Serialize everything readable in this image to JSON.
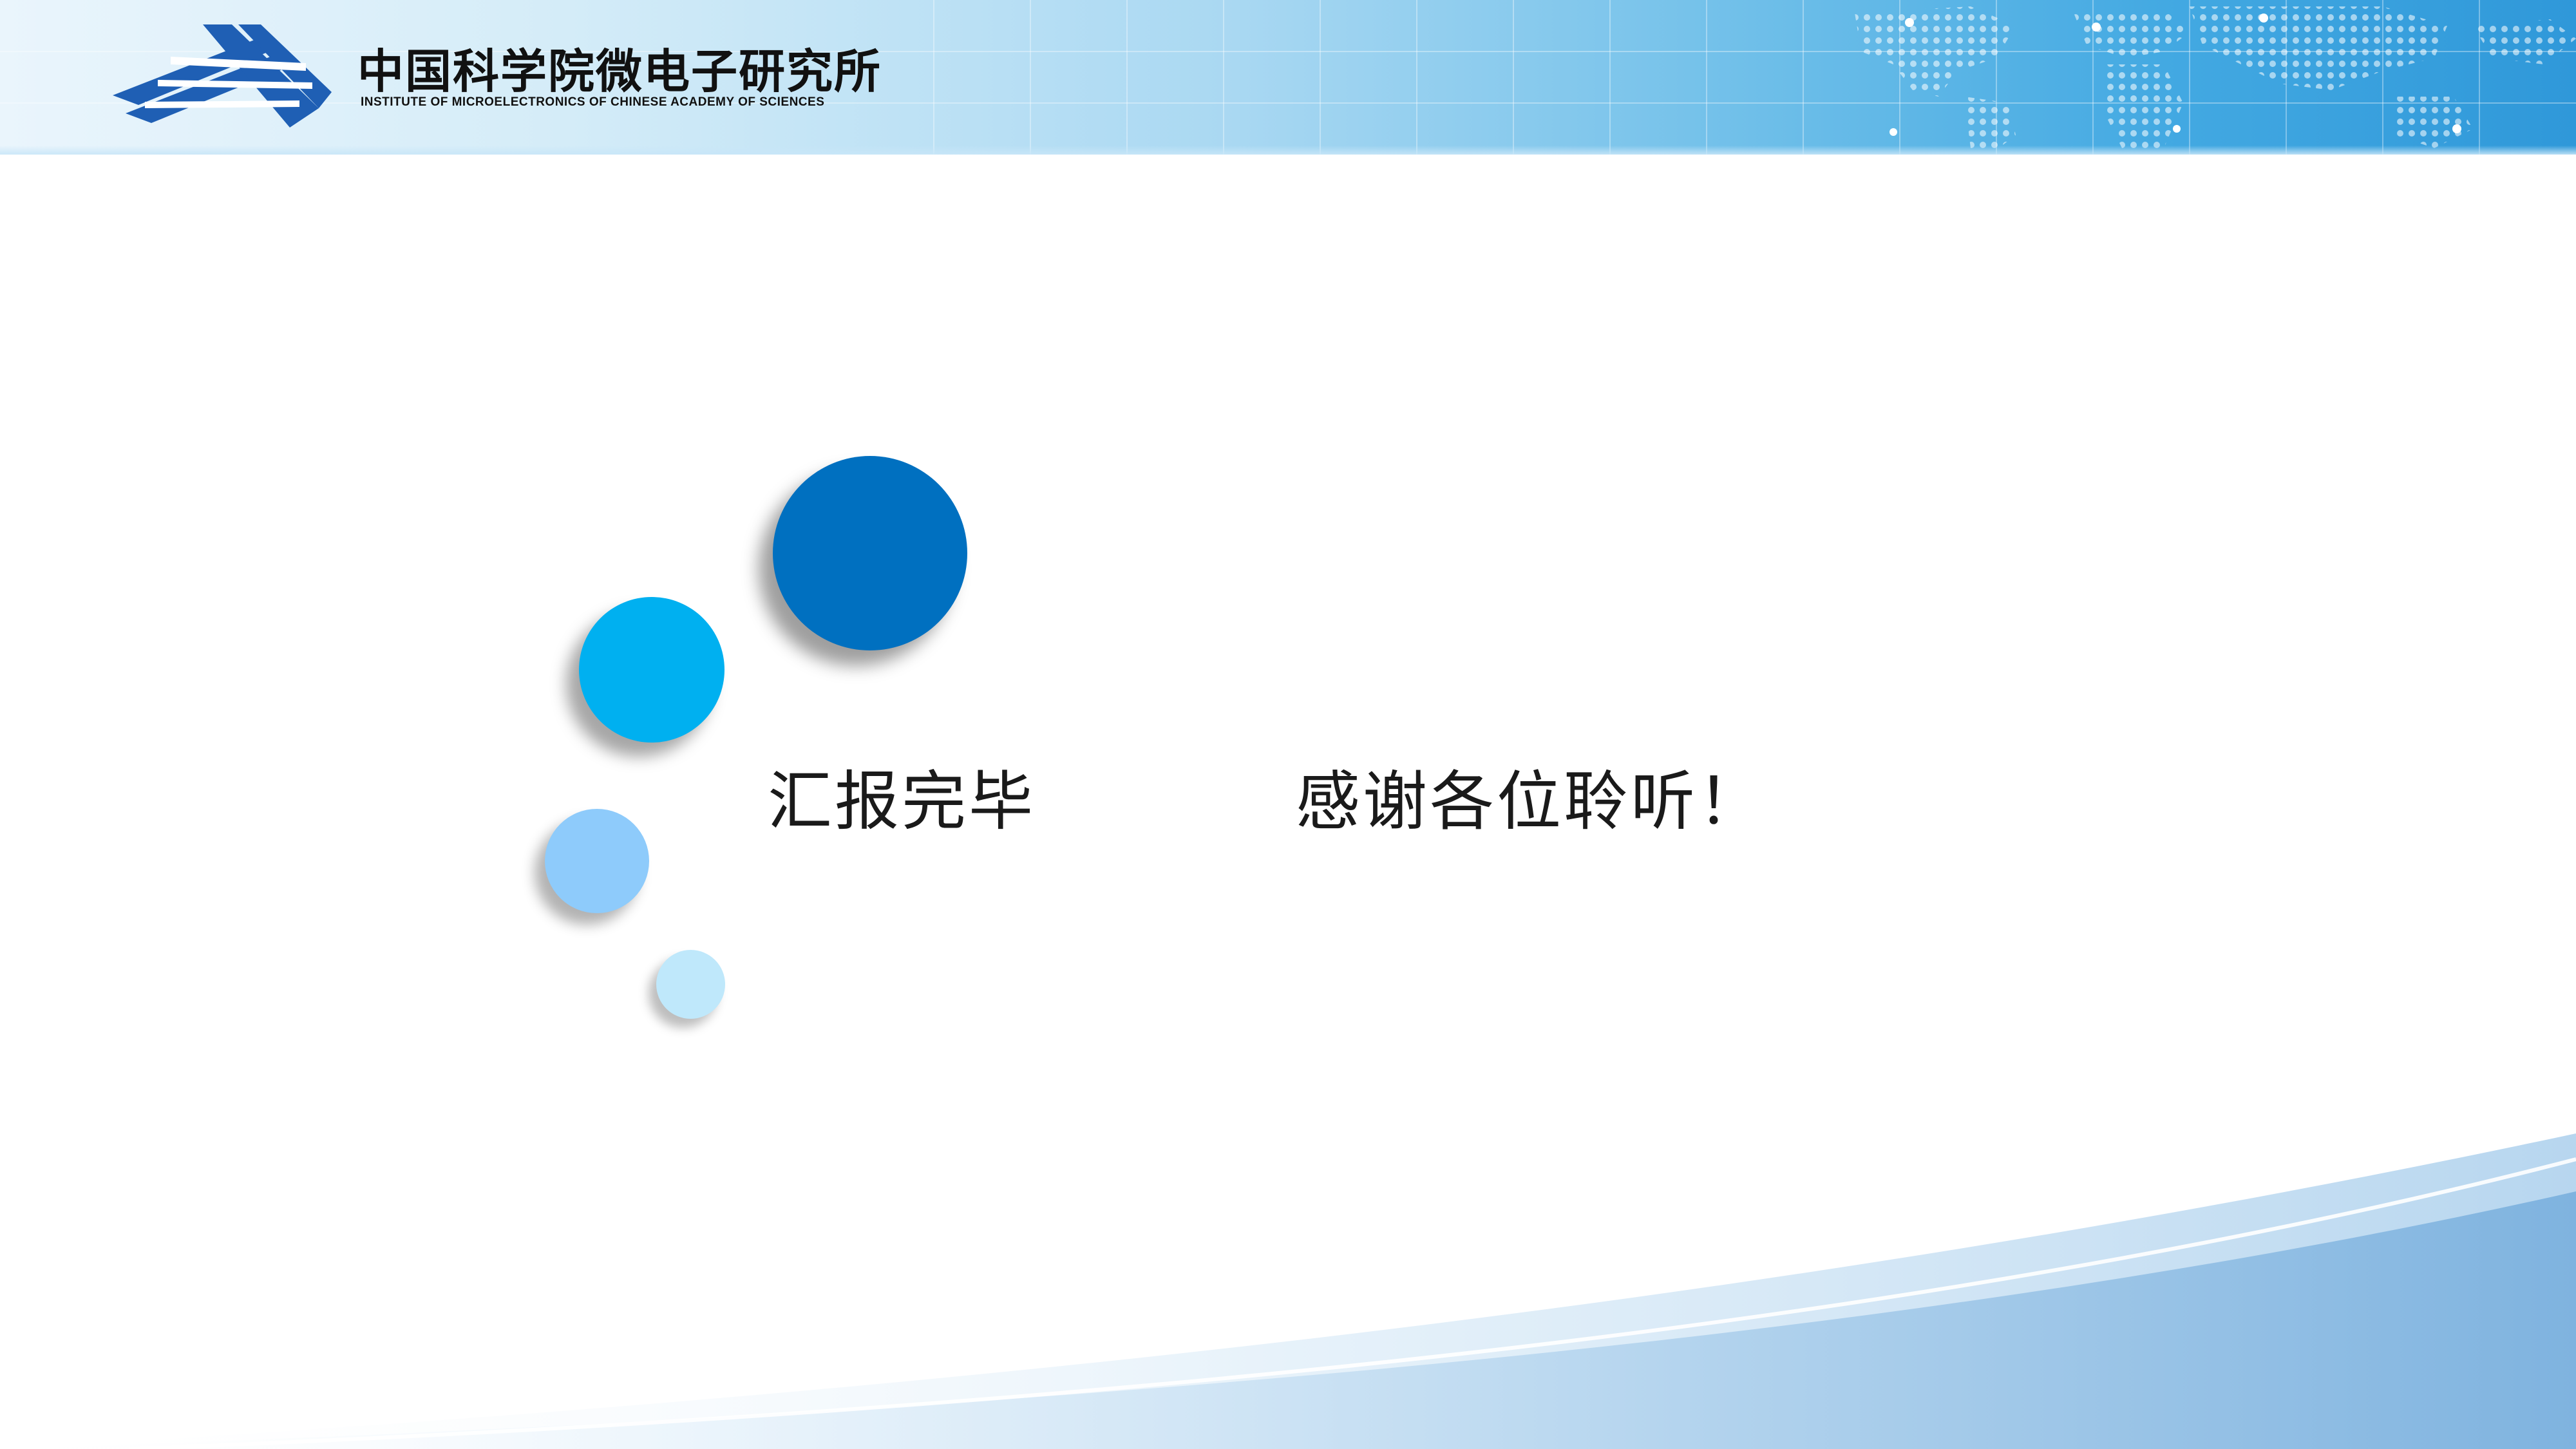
{
  "header": {
    "org_name_cn": "中国科学院微电子研究所",
    "org_name_en": "INSTITUTE OF MICROELECTRONICS OF CHINESE ACADEMY OF SCIENCES",
    "logo_icon": "ime-cas-logo-icon",
    "decoration_icon": "world-map-icon"
  },
  "main": {
    "message_left": "汇报完毕",
    "message_right": "感谢各位聆听！"
  },
  "colors": {
    "circle_dark_blue": "#0070c0",
    "circle_cyan": "#00b0f0",
    "circle_light_blue": "#8ecbfb",
    "circle_pale_blue": "#bfe8fb",
    "logo_blue": "#1f5fb4",
    "text": "#1a1a1a"
  }
}
